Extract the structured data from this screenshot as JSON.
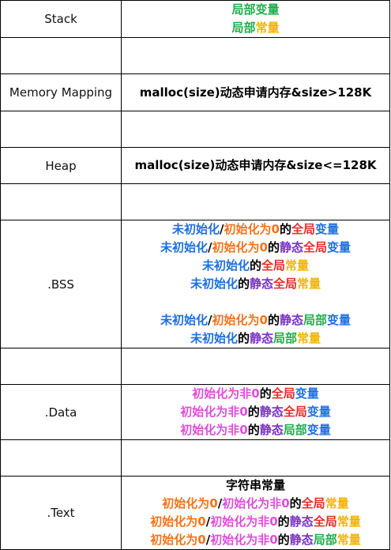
{
  "colors": {
    "blue": "#1f6fe0",
    "orange": "#f5731b",
    "red": "#e82d2d",
    "purple": "#7a32c3",
    "green": "#1fae4a",
    "yellow": "#f0b400",
    "pink": "#dd4fd8",
    "black": "#000000"
  },
  "rows": [
    {
      "label": "Stack",
      "lines": [
        [
          {
            "t": "局部变量",
            "c": "green"
          }
        ],
        [
          {
            "t": "局部",
            "c": "green"
          },
          {
            "t": "常量",
            "c": "yellow"
          }
        ]
      ]
    },
    {
      "label": "",
      "lines": []
    },
    {
      "label": "Memory Mapping",
      "lines": [
        [
          {
            "t": "malloc(size)动态申请内存&size>128K",
            "c": "black"
          }
        ]
      ]
    },
    {
      "label": "",
      "lines": []
    },
    {
      "label": "Heap",
      "lines": [
        [
          {
            "t": "malloc(size)动态申请内存&size<=128K",
            "c": "black"
          }
        ]
      ]
    },
    {
      "label": "",
      "lines": []
    },
    {
      "label": ".BSS",
      "lines": [
        [
          {
            "t": "未初始化",
            "c": "blue"
          },
          {
            "t": "/",
            "c": "black"
          },
          {
            "t": "初始化为0",
            "c": "orange"
          },
          {
            "t": "的",
            "c": "black"
          },
          {
            "t": "全局",
            "c": "red"
          },
          {
            "t": "变量",
            "c": "blue"
          }
        ],
        [
          {
            "t": "未初始化",
            "c": "blue"
          },
          {
            "t": "/",
            "c": "black"
          },
          {
            "t": "初始化为0",
            "c": "orange"
          },
          {
            "t": "的",
            "c": "black"
          },
          {
            "t": "静态",
            "c": "purple"
          },
          {
            "t": "全局",
            "c": "red"
          },
          {
            "t": "变量",
            "c": "blue"
          }
        ],
        [
          {
            "t": "未初始化",
            "c": "blue"
          },
          {
            "t": "的",
            "c": "black"
          },
          {
            "t": "全局",
            "c": "red"
          },
          {
            "t": "常量",
            "c": "yellow"
          }
        ],
        [
          {
            "t": "未初始化",
            "c": "blue"
          },
          {
            "t": "的",
            "c": "black"
          },
          {
            "t": "静态",
            "c": "purple"
          },
          {
            "t": "全局",
            "c": "red"
          },
          {
            "t": "常量",
            "c": "yellow"
          }
        ],
        [],
        [
          {
            "t": "未初始化",
            "c": "blue"
          },
          {
            "t": "/",
            "c": "black"
          },
          {
            "t": "初始化为0",
            "c": "orange"
          },
          {
            "t": "的",
            "c": "black"
          },
          {
            "t": "静态",
            "c": "purple"
          },
          {
            "t": "局部",
            "c": "green"
          },
          {
            "t": "变量",
            "c": "blue"
          }
        ],
        [
          {
            "t": "未初始化",
            "c": "blue"
          },
          {
            "t": "的",
            "c": "black"
          },
          {
            "t": "静态",
            "c": "purple"
          },
          {
            "t": "局部",
            "c": "green"
          },
          {
            "t": "常量",
            "c": "yellow"
          }
        ]
      ]
    },
    {
      "label": "",
      "lines": []
    },
    {
      "label": ".Data",
      "lines": [
        [
          {
            "t": "初始化为非0",
            "c": "pink"
          },
          {
            "t": "的",
            "c": "black"
          },
          {
            "t": "全局",
            "c": "red"
          },
          {
            "t": "变量",
            "c": "blue"
          }
        ],
        [
          {
            "t": "初始化为非0",
            "c": "pink"
          },
          {
            "t": "的",
            "c": "black"
          },
          {
            "t": "静态",
            "c": "purple"
          },
          {
            "t": "全局",
            "c": "red"
          },
          {
            "t": "变量",
            "c": "blue"
          }
        ],
        [
          {
            "t": "初始化为非0",
            "c": "pink"
          },
          {
            "t": "的",
            "c": "black"
          },
          {
            "t": "静态",
            "c": "purple"
          },
          {
            "t": "局部",
            "c": "green"
          },
          {
            "t": "变量",
            "c": "blue"
          }
        ]
      ]
    },
    {
      "label": "",
      "lines": []
    },
    {
      "label": ".Text",
      "lines": [
        [
          {
            "t": "字符串常量",
            "c": "black"
          }
        ],
        [
          {
            "t": "初始化为0",
            "c": "orange"
          },
          {
            "t": "/",
            "c": "black"
          },
          {
            "t": "初始化为非0",
            "c": "pink"
          },
          {
            "t": "的",
            "c": "black"
          },
          {
            "t": "全局",
            "c": "red"
          },
          {
            "t": "常量",
            "c": "yellow"
          }
        ],
        [
          {
            "t": "初始化为0",
            "c": "orange"
          },
          {
            "t": "/",
            "c": "black"
          },
          {
            "t": "初始化为非0",
            "c": "pink"
          },
          {
            "t": "的",
            "c": "black"
          },
          {
            "t": "静态",
            "c": "purple"
          },
          {
            "t": "全局",
            "c": "red"
          },
          {
            "t": "常量",
            "c": "yellow"
          }
        ],
        [
          {
            "t": "初始化为0",
            "c": "orange"
          },
          {
            "t": "/",
            "c": "black"
          },
          {
            "t": "初始化为非0",
            "c": "pink"
          },
          {
            "t": "的",
            "c": "black"
          },
          {
            "t": "静态",
            "c": "purple"
          },
          {
            "t": "局部",
            "c": "green"
          },
          {
            "t": "常量",
            "c": "yellow"
          }
        ]
      ]
    }
  ]
}
